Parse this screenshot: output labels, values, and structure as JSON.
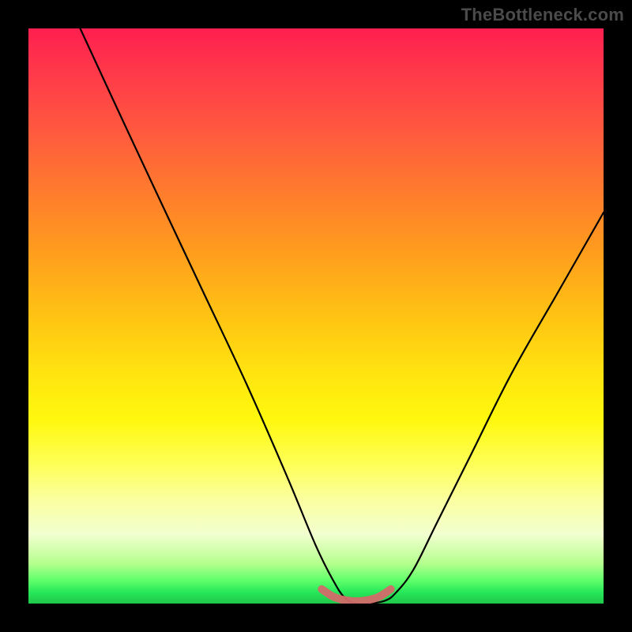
{
  "watermark": "TheBottleneck.com",
  "chart_data": {
    "type": "line",
    "title": "",
    "xlabel": "",
    "ylabel": "",
    "xlim": [
      0,
      100
    ],
    "ylim": [
      0,
      100
    ],
    "grid": false,
    "legend": false,
    "series": [
      {
        "name": "curve",
        "color": "#000000",
        "x": [
          9,
          15,
          22,
          30,
          38,
          45,
          50,
          53,
          55,
          57,
          59,
          62,
          64,
          67,
          71,
          77,
          84,
          92,
          100
        ],
        "y": [
          100,
          87,
          72,
          55,
          38,
          22,
          10,
          4,
          1,
          0,
          0,
          0.5,
          2,
          6,
          14,
          26,
          40,
          54,
          68
        ]
      },
      {
        "name": "flat-marker",
        "color": "#d36a6a",
        "x": [
          51,
          53,
          55,
          57,
          59,
          61,
          63
        ],
        "y": [
          2.5,
          1.2,
          0.6,
          0.4,
          0.6,
          1.2,
          2.5
        ]
      }
    ],
    "background_gradient": {
      "top": "#ff1f4f",
      "mid": "#ffe40f",
      "bottom": "#1ec74a"
    }
  }
}
